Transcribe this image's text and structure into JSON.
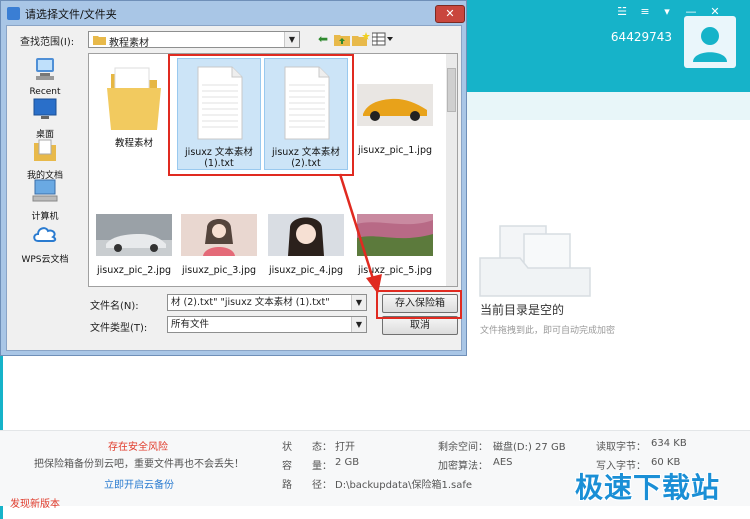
{
  "app": {
    "user_id": "64429743",
    "window_controls": [
      "☱",
      "≡",
      "▾",
      "—",
      "✕"
    ],
    "empty_title": "当前目录是空的",
    "empty_hint": "文件拖拽到此，即可自动完成加密",
    "status": {
      "warning_title": "存在安全风险",
      "warning_text": "把保险箱备份到云吧，重要文件再也不会丢失！",
      "cloud_link": "立即开启云备份",
      "state_label": "状　　态：",
      "state_value": "打开",
      "capacity_label": "容　　量：",
      "capacity_value": "2 GB",
      "path_label": "路　　径：",
      "path_value": "D:\\backupdata\\保险箱1.safe",
      "free_label": "剩余空间：",
      "free_value": "磁盘(D:) 27 GB",
      "algo_label": "加密算法：",
      "algo_value": "AES",
      "read_label": "读取字节：",
      "read_value": "634 KB",
      "write_label": "写入字节：",
      "write_value": "60 KB"
    },
    "new_version": "发现新版本",
    "watermark": "极速下载站"
  },
  "dialog": {
    "title": "请选择文件/文件夹",
    "close_glyph": "✕",
    "look_in_label": "查找范围(I):",
    "look_in_value": "教程素材",
    "places": [
      {
        "label": "Recent"
      },
      {
        "label": "桌面"
      },
      {
        "label": "我的文档"
      },
      {
        "label": "计算机"
      },
      {
        "label": "WPS云文档"
      }
    ],
    "files": [
      {
        "name": "教程素材"
      },
      {
        "name": "jisuxz 文本素材 (1).txt"
      },
      {
        "name": "jisuxz 文本素材 (2).txt"
      },
      {
        "name": "jisuxz_pic_1.jpg"
      },
      {
        "name": "jisuxz_pic_2.jpg"
      },
      {
        "name": "jisuxz_pic_3.jpg"
      },
      {
        "name": "jisuxz_pic_4.jpg"
      },
      {
        "name": "jisuxz_pic_5.jpg"
      }
    ],
    "filename_label": "文件名(N):",
    "filename_value": "材 (2).txt\" \"jisuxz 文本素材 (1).txt\"",
    "filetype_label": "文件类型(T):",
    "filetype_value": "所有文件",
    "save_button": "存入保险箱",
    "cancel_button": "取消"
  }
}
